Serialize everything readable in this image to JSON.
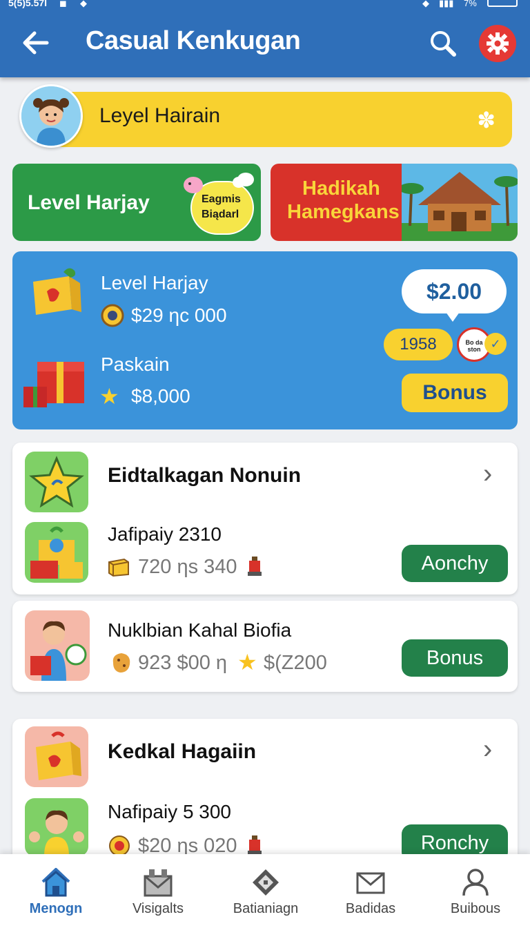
{
  "status_bar": {
    "time": "5(5)5.57I",
    "battery": "7%"
  },
  "app_bar": {
    "title": "Casual Kenkugan"
  },
  "level_banner": {
    "label": "Leyel Hairain"
  },
  "promo_green": {
    "label": "Level Harjay",
    "bubble_line1": "Eagmis",
    "bubble_line2": "Biądarl"
  },
  "promo_red": {
    "line1": "Hadikah",
    "line2": "Hamegkans"
  },
  "featured": {
    "item1_title": "Level Harjay",
    "item1_value": "$29 ηc 000",
    "item2_title": "Paskain",
    "item2_value": "$8,000",
    "price": "$2.00",
    "chip": "1958",
    "badge_text": "Bo da ston",
    "bonus_button": "Bonus"
  },
  "section1": {
    "title": "Eidtalkagan Nonuin",
    "item_name": "Jafipaiy 2310",
    "item_meta": "720 ηs 340",
    "button": "Aonchy"
  },
  "section2": {
    "item_name": "Nuklbian Kahal Biofia",
    "item_meta_a": "923 $00 η",
    "item_meta_b": "$(Z200",
    "button": "Bonus"
  },
  "section3": {
    "title": "Kedkal Hagaiin",
    "item_name": "Nafipaiy 5 300",
    "item_meta": "$20 ηs 020",
    "button": "Ronchy"
  },
  "bottom_nav": [
    {
      "label": "Menogn",
      "icon": "home-icon",
      "active": true
    },
    {
      "label": "Visigalts",
      "icon": "mail-stack-icon",
      "active": false
    },
    {
      "label": "Batianiagn",
      "icon": "gift-diamond-icon",
      "active": false
    },
    {
      "label": "Badidas",
      "icon": "envelope-icon",
      "active": false
    },
    {
      "label": "Buibous",
      "icon": "user-icon",
      "active": false
    }
  ],
  "colors": {
    "primary": "#2f6fb9",
    "accent_yellow": "#f8d12f",
    "green": "#23814a",
    "red": "#d8322a",
    "card_blue": "#3b93da"
  }
}
